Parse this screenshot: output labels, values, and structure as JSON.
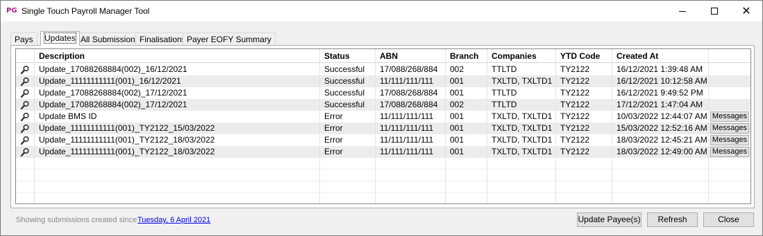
{
  "window": {
    "title": "Single Touch Payroll Manager Tool",
    "app_icon_text": "PG"
  },
  "tabs": [
    {
      "label": "Pays"
    },
    {
      "label": "Updates",
      "active": true
    },
    {
      "label": "All Submissions"
    },
    {
      "label": "Finalisations"
    },
    {
      "label": "Payer EOFY Summary"
    }
  ],
  "grid": {
    "columns": [
      "Description",
      "Status",
      "ABN",
      "Branch",
      "Companies",
      "YTD Code",
      "Created At"
    ],
    "messages_label": "Messages",
    "rows": [
      {
        "description": "Update_17088268884(002)_16/12/2021",
        "status": "Successful",
        "abn": "17/088/268/884",
        "branch": "002",
        "companies": "TTLTD",
        "ytd_code": "TY2122",
        "created_at": "16/12/2021 1:39:48 AM",
        "has_messages": false
      },
      {
        "description": "Update_11111111111(001)_16/12/2021",
        "status": "Successful",
        "abn": "11/111/111/111",
        "branch": "001",
        "companies": "TXLTD, TXLTD1",
        "ytd_code": "TY2122",
        "created_at": "16/12/2021 10:12:58 AM",
        "has_messages": false
      },
      {
        "description": "Update_17088268884(002)_17/12/2021",
        "status": "Successful",
        "abn": "17/088/268/884",
        "branch": "001",
        "companies": "TTLTD",
        "ytd_code": "TY2122",
        "created_at": "16/12/2021 9:49:52 PM",
        "has_messages": false
      },
      {
        "description": "Update_17088268884(002)_17/12/2021",
        "status": "Successful",
        "abn": "17/088/268/884",
        "branch": "002",
        "companies": "TTLTD",
        "ytd_code": "TY2122",
        "created_at": "17/12/2021 1:47:04 AM",
        "has_messages": false
      },
      {
        "description": "Update BMS ID",
        "status": "Error",
        "abn": "11/111/111/111",
        "branch": "001",
        "companies": "TXLTD, TXLTD1",
        "ytd_code": "TY2122",
        "created_at": "10/03/2022 12:44:07 AM",
        "has_messages": true
      },
      {
        "description": "Update_11111111111(001)_TY2122_15/03/2022",
        "status": "Error",
        "abn": "11/111/111/111",
        "branch": "001",
        "companies": "TXLTD, TXLTD1",
        "ytd_code": "TY2122",
        "created_at": "15/03/2022 12:52:16 AM",
        "has_messages": true
      },
      {
        "description": "Update_11111111111(001)_TY2122_18/03/2022",
        "status": "Error",
        "abn": "11/111/111/111",
        "branch": "001",
        "companies": "TXLTD, TXLTD1",
        "ytd_code": "TY2122",
        "created_at": "18/03/2022 12:45:21 AM",
        "has_messages": true
      },
      {
        "description": "Update_11111111111(001)_TY2122_18/03/2022",
        "status": "Error",
        "abn": "11/111/111/111",
        "branch": "001",
        "companies": "TXLTD, TXLTD1",
        "ytd_code": "TY2122",
        "created_at": "18/03/2022 12:49:00 AM",
        "has_messages": true
      }
    ]
  },
  "footer": {
    "status_text": "Showing submissions created since",
    "date_link": "Tuesday, 6 April 2021",
    "update_payees_label": "Update Payee(s)",
    "refresh_label": "Refresh",
    "close_label": "Close"
  },
  "colors": {
    "alt_row": "#ececec",
    "link": "#0000ee",
    "app_icon": "#b0168f"
  }
}
